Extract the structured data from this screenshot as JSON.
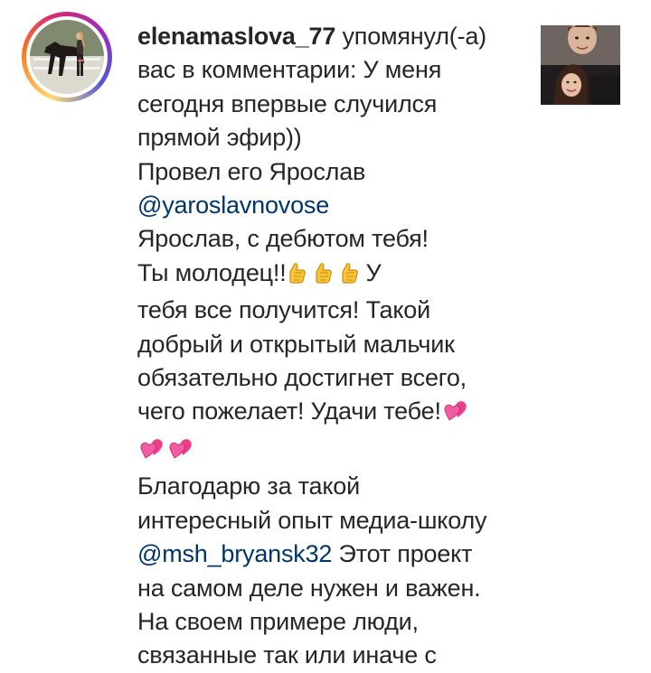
{
  "notification": {
    "username": "elenamaslova_77",
    "action": "упомянул(-а)",
    "lines": [
      "вас в комментарии: У меня",
      "сегодня впервые случился",
      "прямой эфир))",
      "Провел его Ярослав"
    ],
    "mention1": "@yaroslavnovose",
    "line_after_mention1": "Ярослав, с дебютом тебя!",
    "thumbs_line_text": "Ты молодец!!",
    "thumbs_line_tail": "У",
    "lines2": [
      "тебя все получится! Такой",
      "добрый и открытый мальчик",
      "обязательно достигнет всего,"
    ],
    "luck_line": "чего пожелает! Удачи тебе!",
    "lines3": [
      "Благодарю за такой",
      "интересный опыт медиа-школу"
    ],
    "mention2": "@msh_bryansk32",
    "mention2_tail": " Этот проект",
    "lines4": [
      "на самом деле нужен и важен.",
      "На своем примере люди,",
      "связанные так или иначе с"
    ]
  },
  "icons": {
    "thumbs": "thumbs-up-icon",
    "hearts": "two-hearts-icon"
  },
  "colors": {
    "text": "#262626",
    "mention": "#003569",
    "story_ring": [
      "#feda75",
      "#fa7e1e",
      "#d62976",
      "#962fbf",
      "#4f5bd5"
    ]
  }
}
